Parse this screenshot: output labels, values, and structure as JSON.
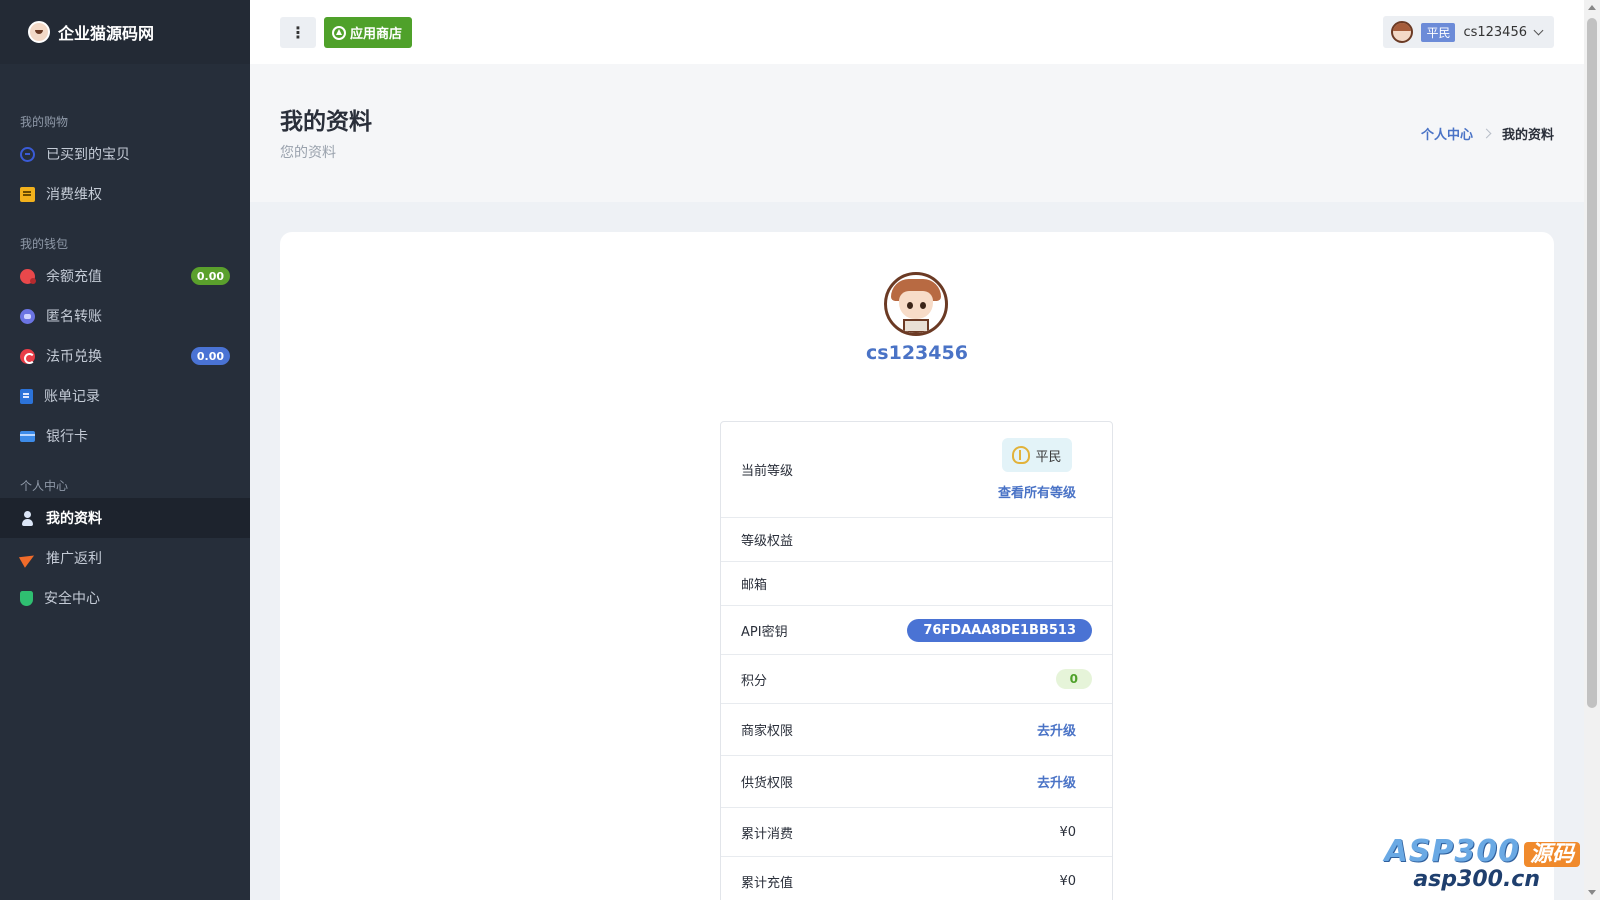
{
  "brand": {
    "name": "企业猫源码网"
  },
  "sidebar": {
    "sections": [
      {
        "title": "我的购物",
        "items": [
          {
            "label": "已买到的宝贝",
            "icon": "order-icon"
          },
          {
            "label": "消费维权",
            "icon": "complaint-icon"
          }
        ]
      },
      {
        "title": "我的钱包",
        "items": [
          {
            "label": "余额充值",
            "icon": "recharge-icon",
            "badge": "0.00",
            "badge_color": "#5aa02c"
          },
          {
            "label": "匿名转账",
            "icon": "transfer-icon"
          },
          {
            "label": "法币兑换",
            "icon": "exchange-icon",
            "badge": "0.00",
            "badge_color": "#4a73d4"
          },
          {
            "label": "账单记录",
            "icon": "bill-icon"
          },
          {
            "label": "银行卡",
            "icon": "bank-card-icon"
          }
        ]
      },
      {
        "title": "个人中心",
        "items": [
          {
            "label": "我的资料",
            "icon": "user-icon",
            "active": true
          },
          {
            "label": "推广返利",
            "icon": "paper-plane-icon"
          },
          {
            "label": "安全中心",
            "icon": "shield-icon"
          }
        ]
      }
    ]
  },
  "topbar": {
    "menu_label": "⋮",
    "store_label": "应用商店",
    "user": {
      "level": "平民",
      "name": "cs123456"
    }
  },
  "page": {
    "title": "我的资料",
    "subtitle": "您的资料",
    "breadcrumb": {
      "parent": "个人中心",
      "current": "我的资料"
    }
  },
  "profile": {
    "username": "cs123456",
    "level_label": "当前等级",
    "level_name": "平民",
    "view_levels": "查看所有等级",
    "rights_label": "等级权益",
    "email_label": "邮箱",
    "api_label": "API密钥",
    "api_key": "76FDAAA8DE1BB513",
    "points_label": "积分",
    "points": "0",
    "merchant_label": "商家权限",
    "merchant_action": "去升级",
    "supply_label": "供货权限",
    "supply_action": "去升级",
    "spent_label": "累计消费",
    "spent": "¥0",
    "recharged_label": "累计充值",
    "recharged": "¥0"
  },
  "watermark": {
    "top": "ASP300",
    "tag": "源码",
    "bottom": "asp300.cn"
  },
  "colors": {
    "sidebar_bg": "#262e3a",
    "accent_blue": "#4a73c6",
    "green": "#4fa12a"
  }
}
